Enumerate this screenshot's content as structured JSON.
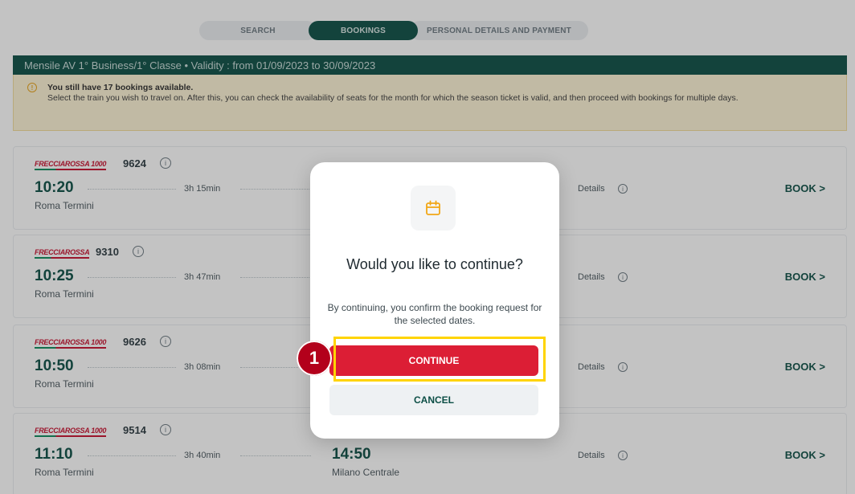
{
  "stepper": {
    "steps": [
      {
        "label": "SEARCH",
        "active": false
      },
      {
        "label": "BOOKINGS",
        "active": true
      },
      {
        "label": "PERSONAL DETAILS AND PAYMENT",
        "active": false
      }
    ]
  },
  "titlebar": {
    "text": "Mensile AV 1° Business/1° Classe • Validity : from 01/09/2023 to 30/09/2023"
  },
  "banner": {
    "warning_icon": "warning-icon",
    "headline": "You still have 17 bookings available.",
    "description": "Select the train you wish to travel on. After this, you can check the availability of seats for the month for which the season ticket is valid, and then proceed with bookings for multiple days."
  },
  "trains": [
    {
      "brand": "FRECCIAROSSA 1000",
      "number": "9624",
      "departure_time": "10:20",
      "duration": "3h 15min",
      "departure_station": "Roma Termini",
      "arrival_time": "",
      "arrival_station": "",
      "details_label": "Details",
      "book_label": "BOOK >"
    },
    {
      "brand": "FRECCIAROSSA",
      "number": "9310",
      "departure_time": "10:25",
      "duration": "3h 47min",
      "departure_station": "Roma Termini",
      "arrival_time": "",
      "arrival_station": "",
      "details_label": "Details",
      "book_label": "BOOK >"
    },
    {
      "brand": "FRECCIAROSSA 1000",
      "number": "9626",
      "departure_time": "10:50",
      "duration": "3h 08min",
      "departure_station": "Roma Termini",
      "arrival_time": "",
      "arrival_station": "",
      "details_label": "Details",
      "book_label": "BOOK >"
    },
    {
      "brand": "FRECCIAROSSA 1000",
      "number": "9514",
      "departure_time": "11:10",
      "duration": "3h 40min",
      "departure_station": "Roma Termini",
      "arrival_time": "14:50",
      "arrival_station": "Milano Centrale",
      "details_label": "Details",
      "book_label": "BOOK >"
    }
  ],
  "modal": {
    "icon": "calendar-icon",
    "title": "Would you like to continue?",
    "text": "By continuing, you confirm the booking request for the selected dates.",
    "continue_label": "CONTINUE",
    "cancel_label": "CANCEL"
  },
  "annotation": {
    "step_number": "1",
    "highlight_color": "#ffd400",
    "marker_color": "#b3001b"
  },
  "colors": {
    "brand_green": "#0c4e45",
    "brand_red": "#dc1e35"
  }
}
